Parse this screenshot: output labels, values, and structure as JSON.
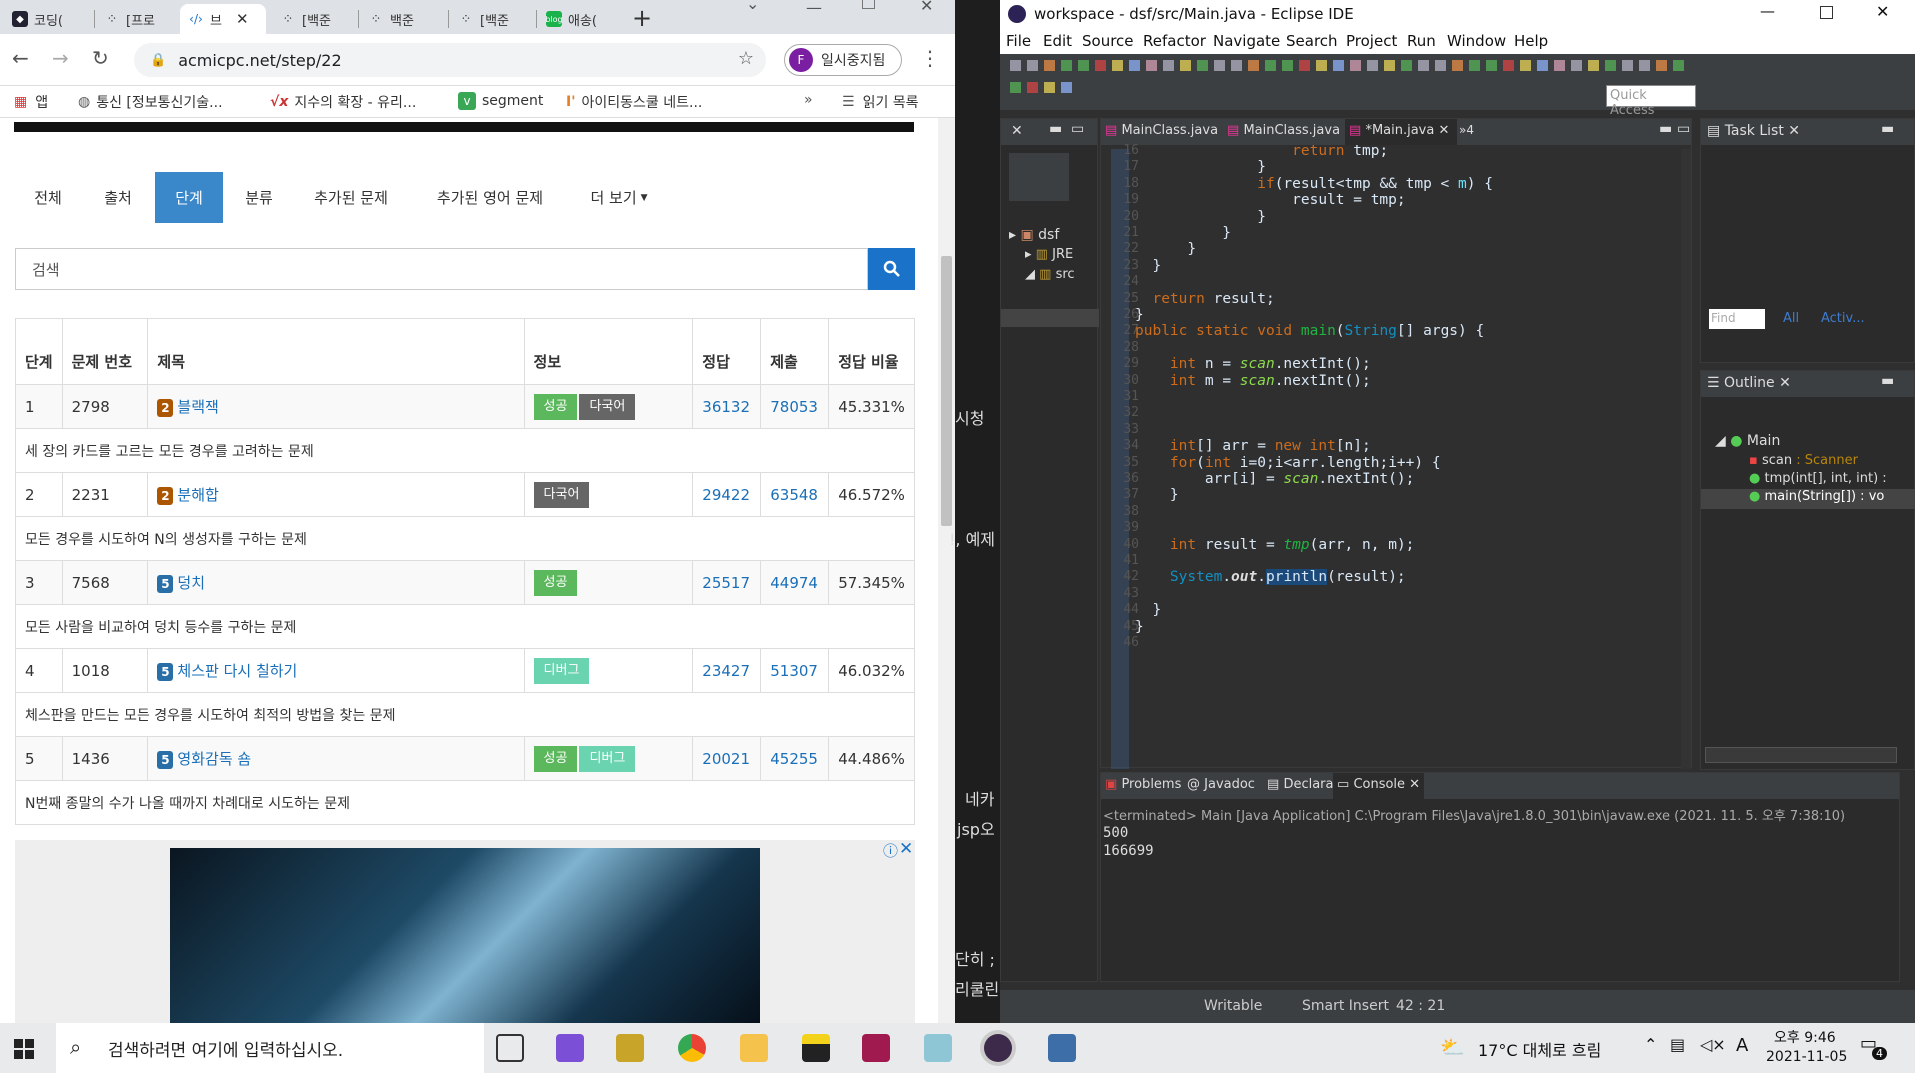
{
  "chrome": {
    "tabs": [
      {
        "label": "코딩(",
        "icon": "coding-icon"
      },
      {
        "label": "[프로",
        "icon": "tistory-icon"
      },
      {
        "label": "브",
        "icon": "code-icon",
        "active": true
      },
      {
        "label": "[백준",
        "icon": "tistory-icon"
      },
      {
        "label": "백준",
        "icon": "tistory-icon"
      },
      {
        "label": "[백준",
        "icon": "tistory-icon"
      },
      {
        "label": "애송(",
        "icon": "blog-icon"
      }
    ],
    "address": "acmicpc.net/step/22",
    "profile_initial": "F",
    "profile_label": "일시중지됨",
    "bookmarks": [
      "앱",
      "통신 [정보통신기술...",
      "지수의 확장 - 유리...",
      "segment",
      "아이티동스쿨 네트...",
      "읽기 목록"
    ],
    "nav_tabs": [
      "전체",
      "출처",
      "단계",
      "분류",
      "추가된 문제",
      "추가된 영어 문제",
      "더 보기"
    ],
    "search_placeholder": "검색",
    "table_headers": [
      "단계",
      "문제 번호",
      "제목",
      "정보",
      "정답",
      "제출",
      "정답 비율"
    ],
    "rows": [
      {
        "step": "1",
        "id": "2798",
        "tier": "2",
        "title": "블랙잭",
        "badges": [
          "성공",
          "다국어"
        ],
        "correct": "36132",
        "submit": "78053",
        "ratio": "45.331%",
        "desc": "세 장의 카드를 고르는 모든 경우를 고려하는 문제"
      },
      {
        "step": "2",
        "id": "2231",
        "tier": "2",
        "title": "분해합",
        "badges": [
          "다국어"
        ],
        "correct": "29422",
        "submit": "63548",
        "ratio": "46.572%",
        "desc": "모든 경우를 시도하여 N의 생성자를 구하는 문제"
      },
      {
        "step": "3",
        "id": "7568",
        "tier": "5",
        "title": "덩치",
        "badges": [
          "성공"
        ],
        "correct": "25517",
        "submit": "44974",
        "ratio": "57.345%",
        "desc": "모든 사람을 비교하여 덩치 등수를 구하는 문제"
      },
      {
        "step": "4",
        "id": "1018",
        "tier": "5",
        "title": "체스판 다시 칠하기",
        "badges": [
          "디버그"
        ],
        "correct": "23427",
        "submit": "51307",
        "ratio": "46.032%",
        "desc": "체스판을 만드는 모든 경우를 시도하여 최적의 방법을 찾는 문제"
      },
      {
        "step": "5",
        "id": "1436",
        "tier": "5",
        "title": "영화감독 숌",
        "badges": [
          "성공",
          "디버그"
        ],
        "correct": "20021",
        "submit": "45255",
        "ratio": "44.486%",
        "desc": "N번째 종말의 수가 나올 때까지 차례대로 시도하는 문제"
      }
    ],
    "badge_colors": {
      "성공": "#5cb85c",
      "다국어": "#666666",
      "디버그": "#6ad4b0"
    }
  },
  "midstrip": [
    "시청",
    "!, 예제",
    "네카",
    "jsp오",
    "단히 ;",
    "리쿨린"
  ],
  "eclipse": {
    "title": "workspace - dsf/src/Main.java - Eclipse IDE",
    "menu": [
      "File",
      "Edit",
      "Source",
      "Refactor",
      "Navigate",
      "Search",
      "Project",
      "Run",
      "Window",
      "Help"
    ],
    "quick_access": "Quick Access",
    "editor_tabs": [
      "MainClass.java",
      "MainClass.java",
      "*Main.java"
    ],
    "editor_overflow": "»4",
    "task_list": "Task List",
    "find": "Find",
    "all": "All",
    "activate": "Activ...",
    "outline": "Outline",
    "outline_items": [
      "Main",
      "scan : Scanner",
      "tmp(int[], int, int) :",
      "main(String[]) : vo"
    ],
    "tree": [
      "dsf",
      "JRE",
      "src"
    ],
    "console_tabs": [
      "Problems",
      "Javadoc",
      "Declaration",
      "Console"
    ],
    "console_header": "<terminated> Main [Java Application] C:\\Program Files\\Java\\jre1.8.0_301\\bin\\javaw.exe (2021. 11. 5. 오후 7:38:10)",
    "console_output": [
      "500",
      "166699"
    ],
    "status_writable": "Writable",
    "status_insert": "Smart Insert",
    "status_pos": "42 : 21"
  },
  "taskbar": {
    "search_placeholder": "검색하려면 여기에 입력하십시오.",
    "weather": "17°C  대체로 흐림",
    "time": "오후 9:46",
    "date": "2021-11-05",
    "notif_count": "4",
    "ime": "A"
  }
}
